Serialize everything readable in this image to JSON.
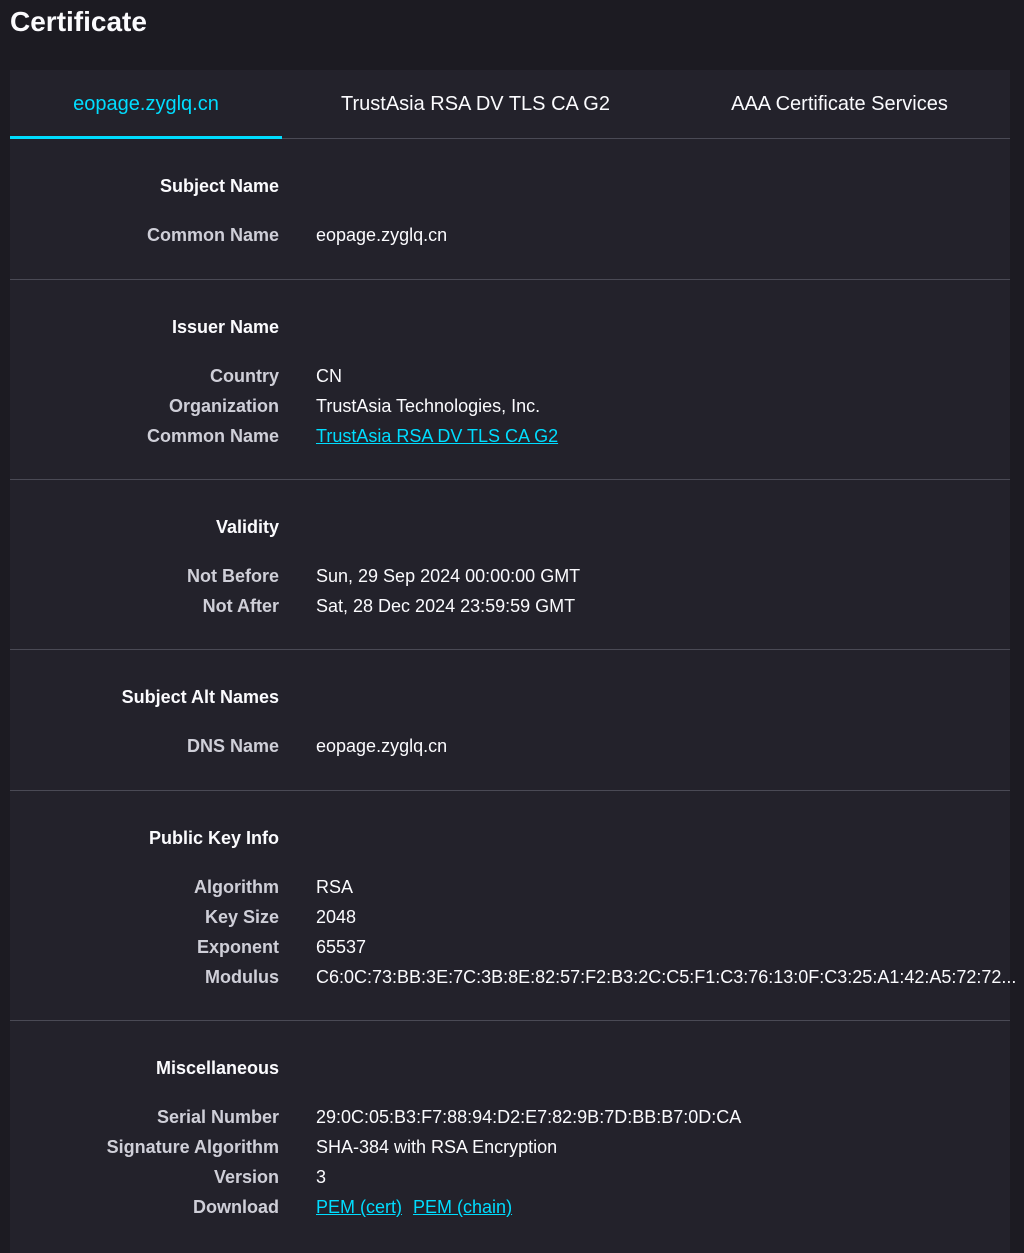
{
  "page_title": "Certificate",
  "tabs": [
    {
      "label": "eopage.zyglq.cn"
    },
    {
      "label": "TrustAsia RSA DV TLS CA G2"
    },
    {
      "label": "AAA Certificate Services"
    }
  ],
  "sections": {
    "subject": {
      "title": "Subject Name",
      "rows": [
        {
          "label": "Common Name",
          "value": "eopage.zyglq.cn"
        }
      ]
    },
    "issuer": {
      "title": "Issuer Name",
      "rows": [
        {
          "label": "Country",
          "value": "CN"
        },
        {
          "label": "Organization",
          "value": "TrustAsia Technologies, Inc."
        },
        {
          "label": "Common Name",
          "value": "TrustAsia RSA DV TLS CA G2"
        }
      ]
    },
    "validity": {
      "title": "Validity",
      "rows": [
        {
          "label": "Not Before",
          "value": "Sun, 29 Sep 2024 00:00:00 GMT"
        },
        {
          "label": "Not After",
          "value": "Sat, 28 Dec 2024 23:59:59 GMT"
        }
      ]
    },
    "san": {
      "title": "Subject Alt Names",
      "rows": [
        {
          "label": "DNS Name",
          "value": "eopage.zyglq.cn"
        }
      ]
    },
    "public_key": {
      "title": "Public Key Info",
      "rows": [
        {
          "label": "Algorithm",
          "value": "RSA"
        },
        {
          "label": "Key Size",
          "value": "2048"
        },
        {
          "label": "Exponent",
          "value": "65537"
        },
        {
          "label": "Modulus",
          "value": "C6:0C:73:BB:3E:7C:3B:8E:82:57:F2:B3:2C:C5:F1:C3:76:13:0F:C3:25:A1:42:A5:72:72..."
        }
      ]
    },
    "misc": {
      "title": "Miscellaneous",
      "rows": [
        {
          "label": "Serial Number",
          "value": "29:0C:05:B3:F7:88:94:D2:E7:82:9B:7D:BB:B7:0D:CA"
        },
        {
          "label": "Signature Algorithm",
          "value": "SHA-384 with RSA Encryption"
        },
        {
          "label": "Version",
          "value": "3"
        },
        {
          "label": "Download",
          "links": [
            "PEM (cert)",
            "PEM (chain)"
          ]
        }
      ]
    }
  },
  "colors": {
    "accent": "#00ddff",
    "background": "#1c1b22",
    "card": "#23222b"
  }
}
